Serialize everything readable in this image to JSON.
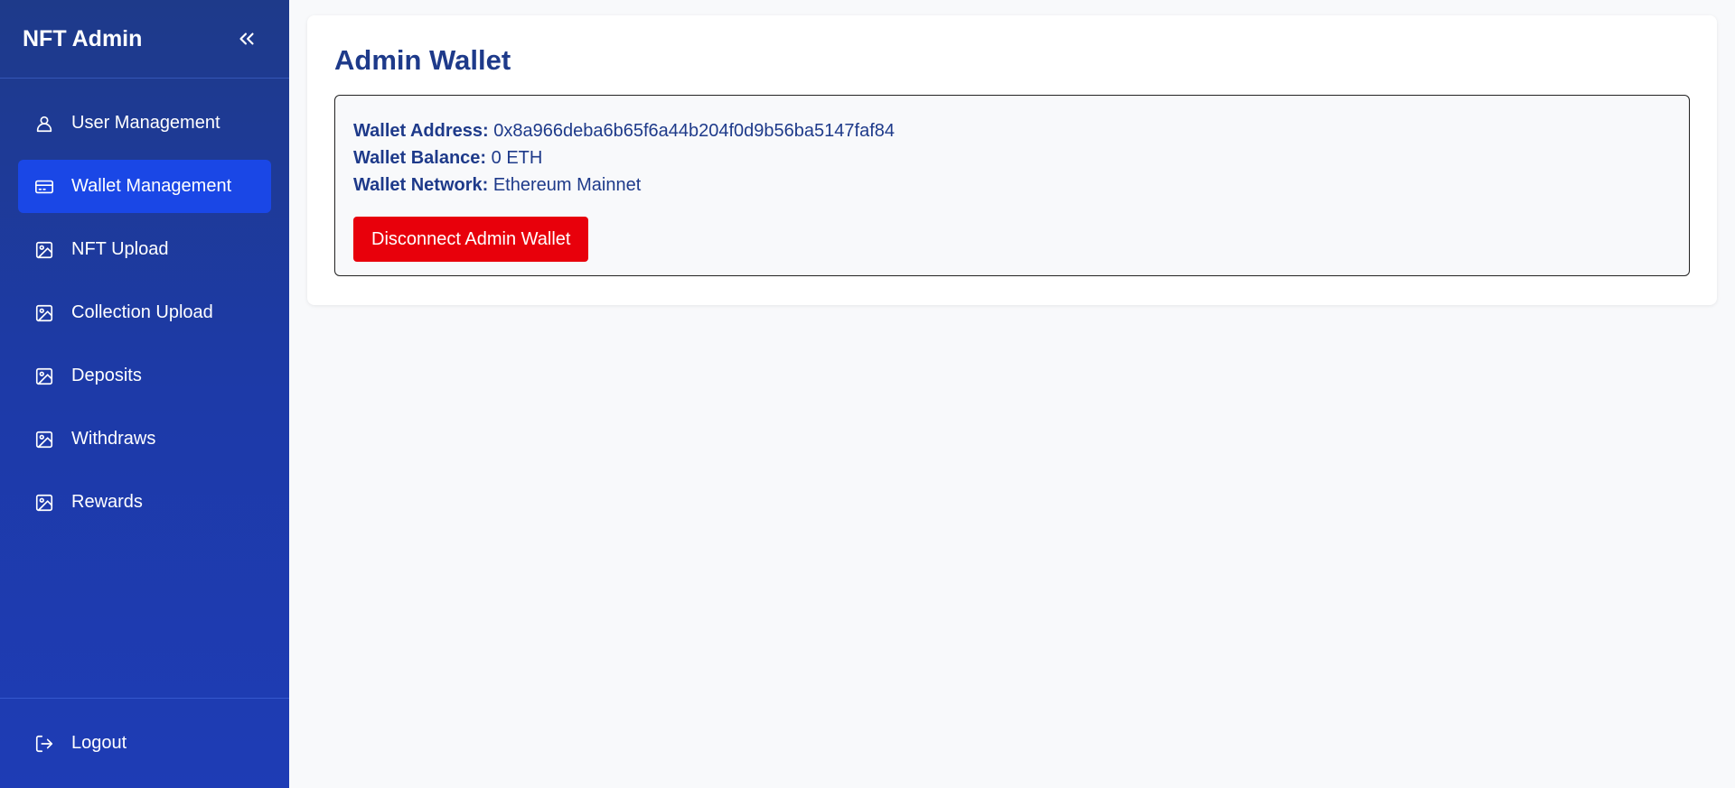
{
  "sidebar": {
    "brand": "NFT Admin",
    "items": [
      {
        "label": "User Management",
        "icon": "user-icon",
        "active": false
      },
      {
        "label": "Wallet Management",
        "icon": "wallet-icon",
        "active": true
      },
      {
        "label": "NFT Upload",
        "icon": "image-icon",
        "active": false
      },
      {
        "label": "Collection Upload",
        "icon": "image-icon",
        "active": false
      },
      {
        "label": "Deposits",
        "icon": "image-icon",
        "active": false
      },
      {
        "label": "Withdraws",
        "icon": "image-icon",
        "active": false
      },
      {
        "label": "Rewards",
        "icon": "image-icon",
        "active": false
      }
    ],
    "logout_label": "Logout"
  },
  "main": {
    "title": "Admin Wallet",
    "wallet": {
      "address_label": "Wallet Address:",
      "address_value": "0x8a966deba6b65f6a44b204f0d9b56ba5147faf84",
      "balance_label": "Wallet Balance:",
      "balance_value": "0 ETH",
      "network_label": "Wallet Network:",
      "network_value": "Ethereum Mainnet"
    },
    "disconnect_label": "Disconnect Admin Wallet"
  },
  "colors": {
    "sidebar_bg": "#1e3a8a",
    "active_item": "#1a47e6",
    "title": "#1e3a8a",
    "danger": "#e8000b"
  }
}
